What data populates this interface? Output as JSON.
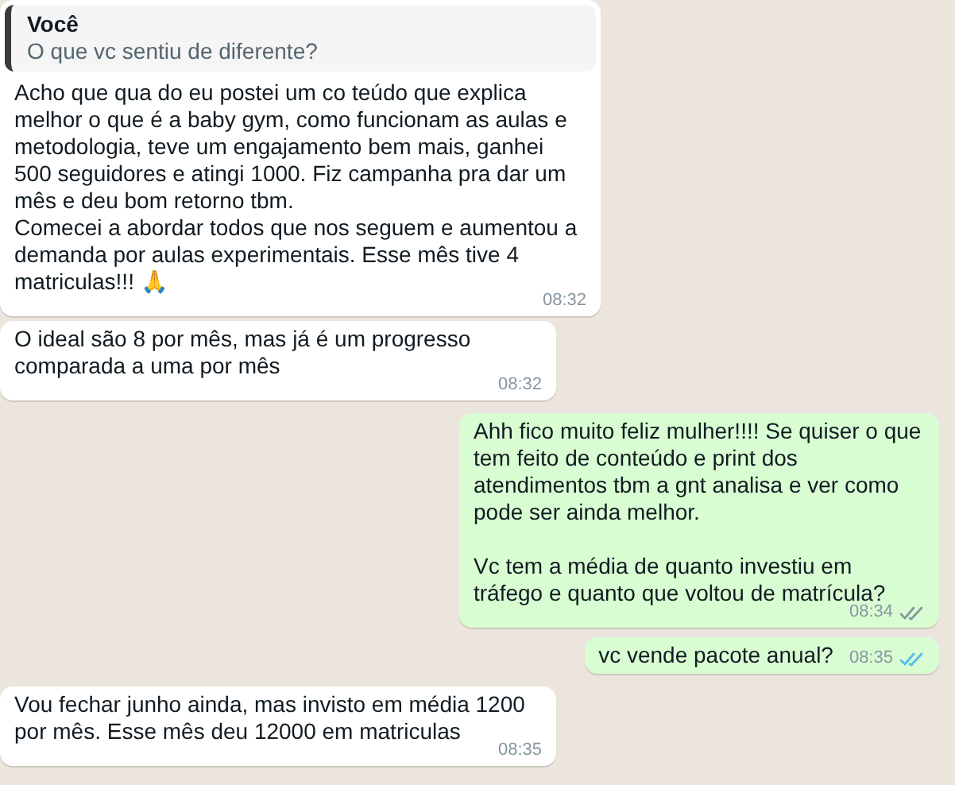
{
  "messages": [
    {
      "outgoing": false,
      "quote": {
        "author": "Você",
        "text": "O que vc sentiu de diferente?"
      },
      "text": "Acho que qua do eu postei um co teúdo que explica melhor o que é a baby gym, como funcionam as aulas e metodologia, teve um engajamento bem mais, ganhei 500 seguidores e atingi 1000. Fiz campanha pra dar um mês e deu bom retorno tbm.\nComecei a abordar todos que nos seguem e aumentou a demanda por aulas experimentais. Esse mês tive 4 matriculas!!! 🙏",
      "time": "08:32"
    },
    {
      "outgoing": false,
      "text": "O ideal são 8 por mês, mas já é um progresso comparada a uma por mês",
      "time": "08:32"
    },
    {
      "outgoing": true,
      "text": "Ahh fico muito feliz mulher!!!! Se quiser o que tem feito de conteúdo e print dos atendimentos tbm a gnt analisa e ver como pode ser ainda melhor.\n\nVc tem a média de quanto investiu em tráfego e quanto que voltou de matrícula?",
      "time": "08:34",
      "read": false
    },
    {
      "outgoing": true,
      "text": "vc vende pacote anual?",
      "time": "08:35",
      "read": true
    },
    {
      "outgoing": false,
      "text": "Vou fechar junho ainda, mas invisto em média 1200 por mês. Esse mês deu 12000 em matriculas",
      "time": "08:35"
    }
  ]
}
